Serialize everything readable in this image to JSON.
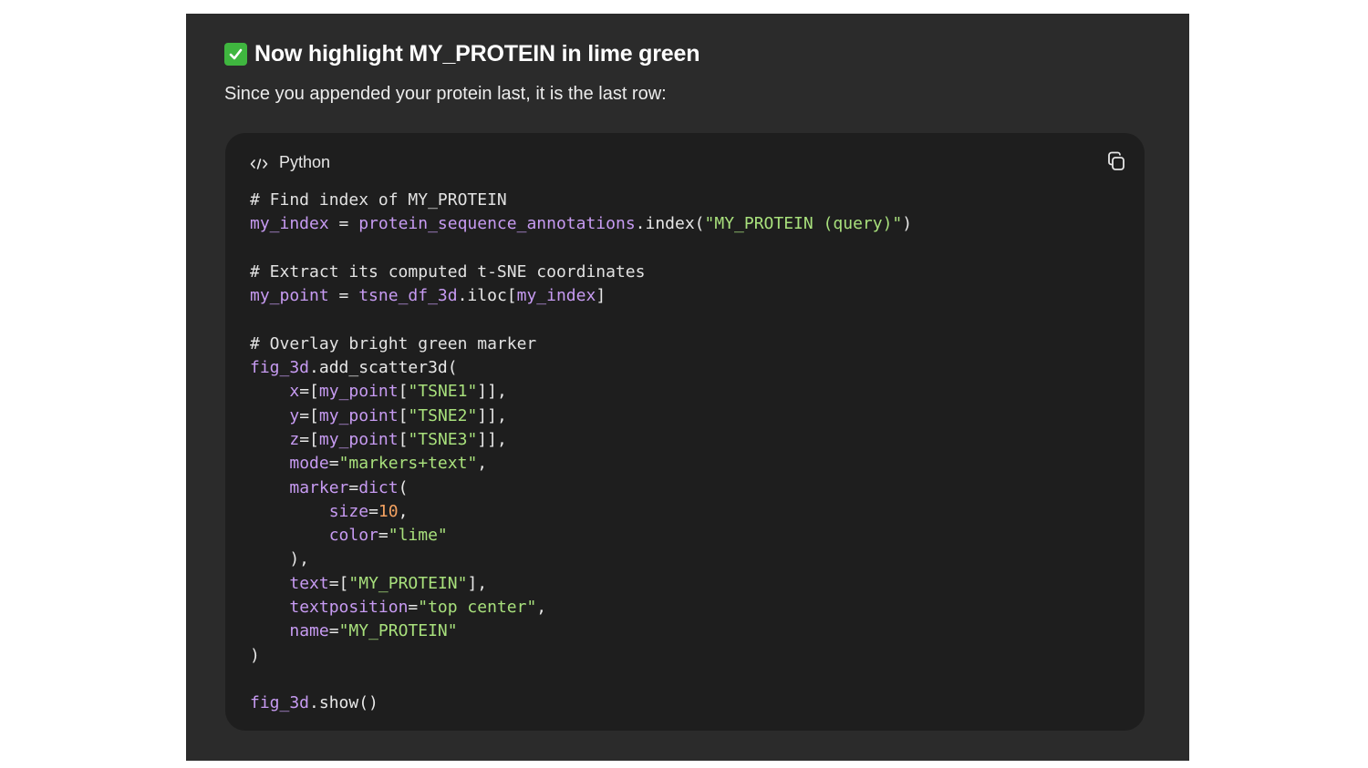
{
  "message": {
    "heading": "Now highlight MY_PROTEIN in lime green",
    "subtitle": "Since you appended your protein last, it is the last row:"
  },
  "code_block": {
    "language": "Python",
    "lines": [
      [
        {
          "t": "# Find index of MY_PROTEIN",
          "c": "comment"
        }
      ],
      [
        {
          "t": "my_index",
          "c": "var"
        },
        {
          "t": " = ",
          "c": "plain"
        },
        {
          "t": "protein_sequence_annotations",
          "c": "var"
        },
        {
          "t": ".index(",
          "c": "plain"
        },
        {
          "t": "\"MY_PROTEIN (query)\"",
          "c": "str"
        },
        {
          "t": ")",
          "c": "plain"
        }
      ],
      [],
      [
        {
          "t": "# Extract its computed t-SNE coordinates",
          "c": "comment"
        }
      ],
      [
        {
          "t": "my_point",
          "c": "var"
        },
        {
          "t": " = ",
          "c": "plain"
        },
        {
          "t": "tsne_df_3d",
          "c": "var"
        },
        {
          "t": ".iloc[",
          "c": "plain"
        },
        {
          "t": "my_index",
          "c": "var"
        },
        {
          "t": "]",
          "c": "plain"
        }
      ],
      [],
      [
        {
          "t": "# Overlay bright green marker",
          "c": "comment"
        }
      ],
      [
        {
          "t": "fig_3d",
          "c": "var"
        },
        {
          "t": ".add_scatter3d(",
          "c": "plain"
        }
      ],
      [
        {
          "t": "    ",
          "c": "plain"
        },
        {
          "t": "x",
          "c": "var"
        },
        {
          "t": "=[",
          "c": "plain"
        },
        {
          "t": "my_point",
          "c": "var"
        },
        {
          "t": "[",
          "c": "plain"
        },
        {
          "t": "\"TSNE1\"",
          "c": "str"
        },
        {
          "t": "]],",
          "c": "plain"
        }
      ],
      [
        {
          "t": "    ",
          "c": "plain"
        },
        {
          "t": "y",
          "c": "var"
        },
        {
          "t": "=[",
          "c": "plain"
        },
        {
          "t": "my_point",
          "c": "var"
        },
        {
          "t": "[",
          "c": "plain"
        },
        {
          "t": "\"TSNE2\"",
          "c": "str"
        },
        {
          "t": "]],",
          "c": "plain"
        }
      ],
      [
        {
          "t": "    ",
          "c": "plain"
        },
        {
          "t": "z",
          "c": "var"
        },
        {
          "t": "=[",
          "c": "plain"
        },
        {
          "t": "my_point",
          "c": "var"
        },
        {
          "t": "[",
          "c": "plain"
        },
        {
          "t": "\"TSNE3\"",
          "c": "str"
        },
        {
          "t": "]],",
          "c": "plain"
        }
      ],
      [
        {
          "t": "    ",
          "c": "plain"
        },
        {
          "t": "mode",
          "c": "var"
        },
        {
          "t": "=",
          "c": "plain"
        },
        {
          "t": "\"markers+text\"",
          "c": "str"
        },
        {
          "t": ",",
          "c": "plain"
        }
      ],
      [
        {
          "t": "    ",
          "c": "plain"
        },
        {
          "t": "marker",
          "c": "var"
        },
        {
          "t": "=",
          "c": "plain"
        },
        {
          "t": "dict",
          "c": "var"
        },
        {
          "t": "(",
          "c": "plain"
        }
      ],
      [
        {
          "t": "        ",
          "c": "plain"
        },
        {
          "t": "size",
          "c": "var"
        },
        {
          "t": "=",
          "c": "plain"
        },
        {
          "t": "10",
          "c": "num"
        },
        {
          "t": ",",
          "c": "plain"
        }
      ],
      [
        {
          "t": "        ",
          "c": "plain"
        },
        {
          "t": "color",
          "c": "var"
        },
        {
          "t": "=",
          "c": "plain"
        },
        {
          "t": "\"lime\"",
          "c": "str"
        }
      ],
      [
        {
          "t": "    ),",
          "c": "plain"
        }
      ],
      [
        {
          "t": "    ",
          "c": "plain"
        },
        {
          "t": "text",
          "c": "var"
        },
        {
          "t": "=[",
          "c": "plain"
        },
        {
          "t": "\"MY_PROTEIN\"",
          "c": "str"
        },
        {
          "t": "],",
          "c": "plain"
        }
      ],
      [
        {
          "t": "    ",
          "c": "plain"
        },
        {
          "t": "textposition",
          "c": "var"
        },
        {
          "t": "=",
          "c": "plain"
        },
        {
          "t": "\"top center\"",
          "c": "str"
        },
        {
          "t": ",",
          "c": "plain"
        }
      ],
      [
        {
          "t": "    ",
          "c": "plain"
        },
        {
          "t": "name",
          "c": "var"
        },
        {
          "t": "=",
          "c": "plain"
        },
        {
          "t": "\"MY_PROTEIN\"",
          "c": "str"
        }
      ],
      [
        {
          "t": ")",
          "c": "plain"
        }
      ],
      [],
      [
        {
          "t": "fig_3d",
          "c": "var"
        },
        {
          "t": ".show()",
          "c": "plain"
        }
      ]
    ]
  },
  "icons": {
    "heading": "check-mark-icon",
    "language": "code-brackets-icon",
    "copy": "copy-icon"
  },
  "colors": {
    "panel_bg": "#2b2b2b",
    "code_bg": "#1e1e1e",
    "check": "#3fb63f",
    "variable": "#c79bf2",
    "string": "#a8e07c",
    "number": "#f4a261"
  }
}
